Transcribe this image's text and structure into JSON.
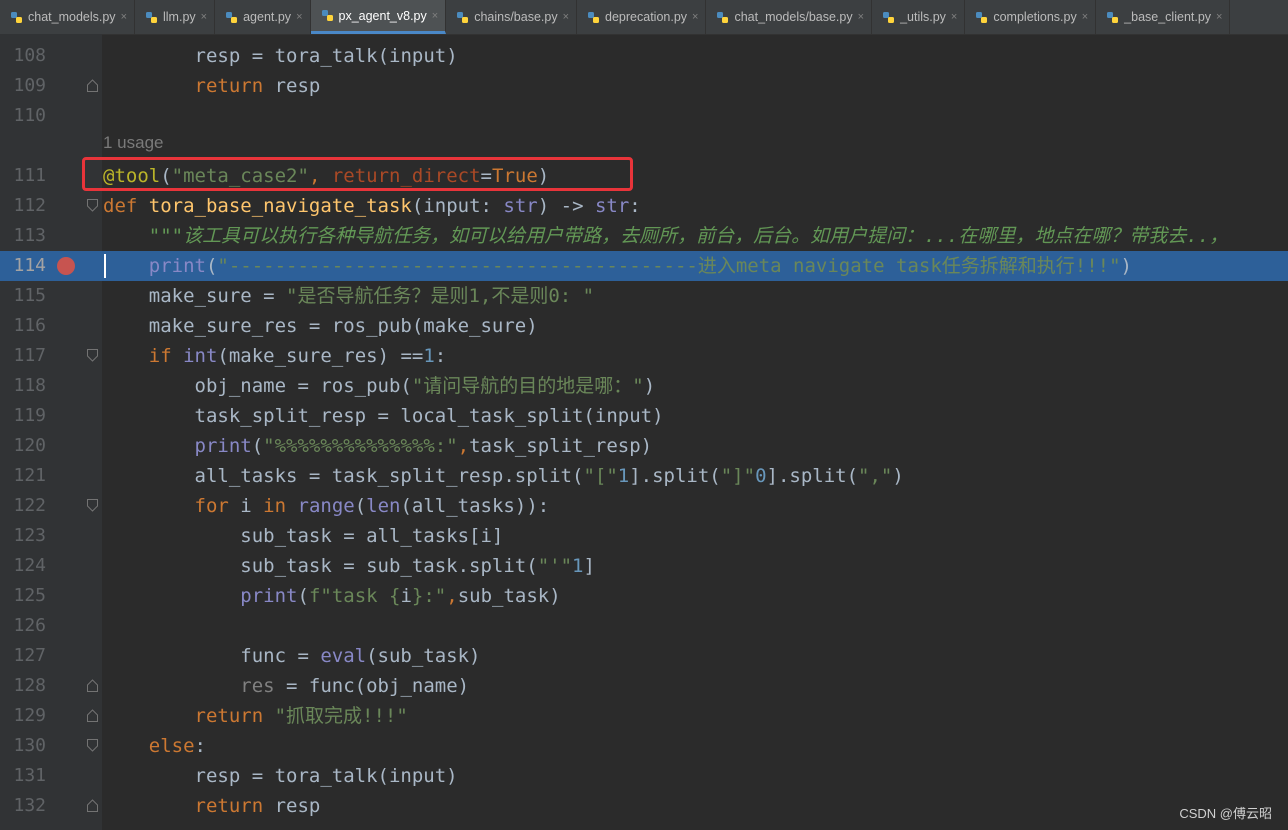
{
  "tabs": [
    {
      "label": "chat_models.py",
      "active": false
    },
    {
      "label": "llm.py",
      "active": false
    },
    {
      "label": "agent.py",
      "active": false
    },
    {
      "label": "px_agent_v8.py",
      "active": true
    },
    {
      "label": "chains/base.py",
      "active": false
    },
    {
      "label": "deprecation.py",
      "active": false
    },
    {
      "label": "chat_models/base.py",
      "active": false
    },
    {
      "label": "_utils.py",
      "active": false
    },
    {
      "label": "completions.py",
      "active": false
    },
    {
      "label": "_base_client.py",
      "active": false
    }
  ],
  "tab_close_glyph": "×",
  "inlay_hint": "1 usage",
  "watermark": "CSDN @傅云昭",
  "colors": {
    "background": "#2b2b2b",
    "current_line": "#2d6099",
    "breakpoint": "#c75450",
    "annotation_box": "#e8343a"
  },
  "current_line": 114,
  "breakpoint_line": 114,
  "lines": [
    {
      "num": "108",
      "tokens": [
        [
          "",
          "        "
        ],
        [
          "",
          "resp"
        ],
        [
          "",
          " = "
        ],
        [
          "",
          "tora_talk"
        ],
        [
          "",
          "(input)"
        ]
      ]
    },
    {
      "num": "109",
      "tokens": [
        [
          "",
          "        "
        ],
        [
          "k",
          "return"
        ],
        [
          "",
          " resp"
        ]
      ]
    },
    {
      "num": "110",
      "tokens": []
    },
    {
      "num": "111",
      "tokens": [
        [
          "dec",
          "@tool"
        ],
        [
          "",
          "("
        ],
        [
          "s",
          "\"meta_case2\""
        ],
        [
          "k",
          ", "
        ],
        [
          "kw",
          "return_direct"
        ],
        [
          "",
          "="
        ],
        [
          "k",
          "True"
        ],
        [
          "",
          ")"
        ]
      ]
    },
    {
      "num": "112",
      "tokens": [
        [
          "k",
          "def "
        ],
        [
          "f",
          "tora_base_navigate_task"
        ],
        [
          "",
          "("
        ],
        [
          "",
          "input"
        ],
        [
          "",
          ": "
        ],
        [
          "b",
          "str"
        ],
        [
          "",
          ") -> "
        ],
        [
          "b",
          "str"
        ],
        [
          "",
          ":"
        ]
      ]
    },
    {
      "num": "113",
      "tokens": [
        [
          "doc",
          "    \"\"\"该工具可以执行各种导航任务，如可以给用户带路，去厕所，前台，后台。如用户提问：...在哪里，地点在哪？带我去..，"
        ]
      ]
    },
    {
      "num": "114",
      "tokens": [
        [
          "",
          "    "
        ],
        [
          "b",
          "print"
        ],
        [
          "",
          "("
        ],
        [
          "s",
          "\"-----------------------------------------进入meta navigate task任务拆解和执行!!!\""
        ],
        [
          "",
          ")"
        ]
      ]
    },
    {
      "num": "115",
      "tokens": [
        [
          "",
          "    make_sure = "
        ],
        [
          "s",
          "\"是否导航任务？是则1,不是则0: \""
        ]
      ]
    },
    {
      "num": "116",
      "tokens": [
        [
          "",
          "    make_sure_res = ros_pub(make_sure)"
        ]
      ]
    },
    {
      "num": "117",
      "tokens": [
        [
          "",
          "    "
        ],
        [
          "k",
          "if "
        ],
        [
          "b",
          "int"
        ],
        [
          "",
          "(make_sure_res) =="
        ],
        [
          "n",
          "1"
        ],
        [
          "",
          ":"
        ]
      ]
    },
    {
      "num": "118",
      "tokens": [
        [
          "",
          "        obj_name = ros_pub("
        ],
        [
          "s",
          "\"请问导航的目的地是哪：\""
        ],
        [
          "",
          ")"
        ]
      ]
    },
    {
      "num": "119",
      "tokens": [
        [
          "",
          "        task_split_resp = local_task_split(input)"
        ]
      ]
    },
    {
      "num": "120",
      "tokens": [
        [
          "",
          "        "
        ],
        [
          "b",
          "print"
        ],
        [
          "",
          "("
        ],
        [
          "s",
          "\"%%%%%%%%%%%%%%:\""
        ],
        [
          "k",
          ","
        ],
        [
          "",
          "task_split_resp)"
        ]
      ]
    },
    {
      "num": "121",
      "tokens": [
        [
          "",
          "        all_tasks = task_split_resp.split("
        ],
        [
          "s",
          "\"[\""
        ],
        [
          ")["
        ],
        [
          "n",
          "1"
        ],
        [
          "",
          "].split("
        ],
        [
          "s",
          "\"]\""
        ],
        [
          ")["
        ],
        [
          "n",
          "0"
        ],
        [
          "",
          "].split("
        ],
        [
          "s",
          "\",\""
        ],
        [
          "",
          ")"
        ]
      ]
    },
    {
      "num": "122",
      "tokens": [
        [
          "",
          "        "
        ],
        [
          "k",
          "for "
        ],
        [
          "",
          "i "
        ],
        [
          "k",
          "in "
        ],
        [
          "b",
          "range"
        ],
        [
          "",
          "("
        ],
        [
          "b",
          "len"
        ],
        [
          "",
          "(all_tasks)):"
        ]
      ]
    },
    {
      "num": "123",
      "tokens": [
        [
          "",
          "            sub_task = all_tasks[i]"
        ]
      ]
    },
    {
      "num": "124",
      "tokens": [
        [
          "",
          "            sub_task = sub_task.split("
        ],
        [
          "s",
          "\"'\""
        ],
        [
          ")["
        ],
        [
          "n",
          "1"
        ],
        [
          "",
          "]"
        ]
      ]
    },
    {
      "num": "125",
      "tokens": [
        [
          "",
          "            "
        ],
        [
          "b",
          "print"
        ],
        [
          "",
          "("
        ],
        [
          "s",
          "f\"task {"
        ],
        [
          "",
          "i"
        ],
        [
          "s",
          "}:\""
        ],
        [
          "k",
          ","
        ],
        [
          "",
          "sub_task)"
        ]
      ]
    },
    {
      "num": "126",
      "tokens": []
    },
    {
      "num": "127",
      "tokens": [
        [
          "",
          "            func = "
        ],
        [
          "b",
          "eval"
        ],
        [
          "",
          "(sub_task)"
        ]
      ]
    },
    {
      "num": "128",
      "tokens": [
        [
          "",
          "            "
        ],
        [
          "gray",
          "res"
        ],
        [
          "",
          " = func(obj_name)"
        ]
      ]
    },
    {
      "num": "129",
      "tokens": [
        [
          "",
          "        "
        ],
        [
          "k",
          "return "
        ],
        [
          "s",
          "\"抓取完成!!!\""
        ]
      ]
    },
    {
      "num": "130",
      "tokens": [
        [
          "",
          "    "
        ],
        [
          "k",
          "else"
        ],
        [
          "",
          ":"
        ]
      ]
    },
    {
      "num": "131",
      "tokens": [
        [
          "",
          "        resp = tora_talk(input)"
        ]
      ]
    },
    {
      "num": "132",
      "tokens": [
        [
          "",
          "        "
        ],
        [
          "k",
          "return"
        ],
        [
          "",
          " resp"
        ]
      ]
    }
  ]
}
